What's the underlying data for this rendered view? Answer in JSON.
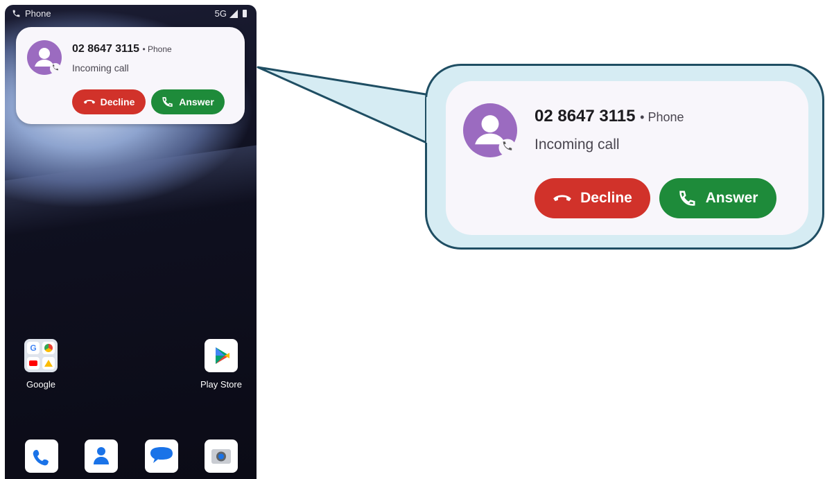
{
  "status_bar": {
    "app_label": "Phone",
    "network": "5G"
  },
  "notification": {
    "caller_number": "02 8647 3115",
    "source_app": "Phone",
    "separator": "•",
    "status": "Incoming call",
    "decline_label": "Decline",
    "answer_label": "Answer"
  },
  "home": {
    "apps": [
      {
        "label": "Google",
        "icon": "google-folder-icon"
      },
      {
        "label": "Play Store",
        "icon": "play-store-icon"
      }
    ],
    "dock": [
      "phone-app-icon",
      "contacts-app-icon",
      "messages-app-icon",
      "camera-app-icon"
    ]
  },
  "colors": {
    "decline": "#d1322a",
    "answer": "#1e8b3a",
    "avatar": "#9b6bc0",
    "callout_fill": "#d6ecf3",
    "callout_border": "#1f4e63"
  }
}
